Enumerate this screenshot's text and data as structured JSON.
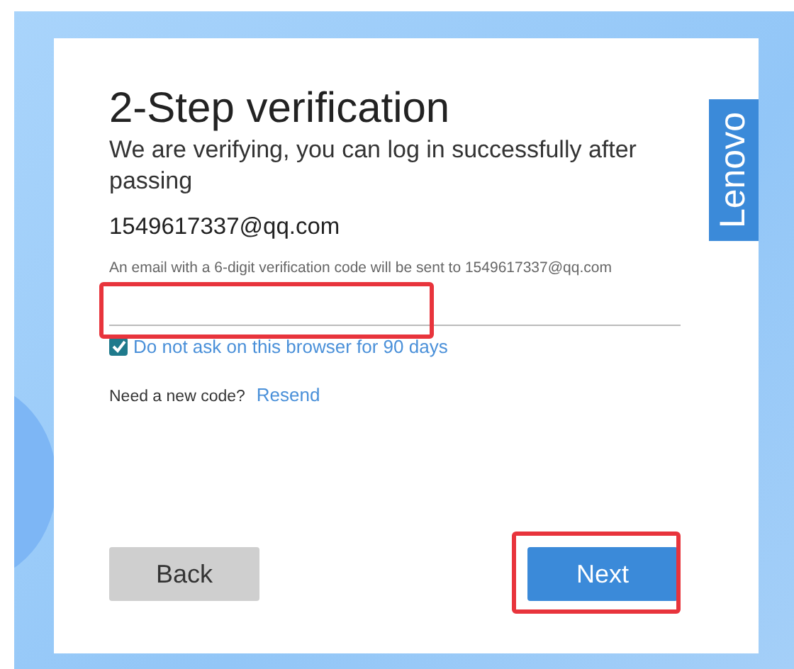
{
  "brand": {
    "logo_text": "Lenovo"
  },
  "title": "2-Step verification",
  "subtitle": "We are verifying, you can log in successfully after passing",
  "account_email": "1549617337@qq.com",
  "code_hint": "An email with a 6-digit verification code will be sent to 1549617337@qq.com",
  "code_field": {
    "highlighted": true
  },
  "remember": {
    "label": "Do not ask on this browser for 90 days",
    "checked": true
  },
  "resend": {
    "prompt": "Need a new code?",
    "link": "Resend"
  },
  "buttons": [
    {
      "kind": "secondary",
      "label": "Back",
      "highlighted": false
    },
    {
      "kind": "primary",
      "label": "Next",
      "highlighted": true
    }
  ]
}
